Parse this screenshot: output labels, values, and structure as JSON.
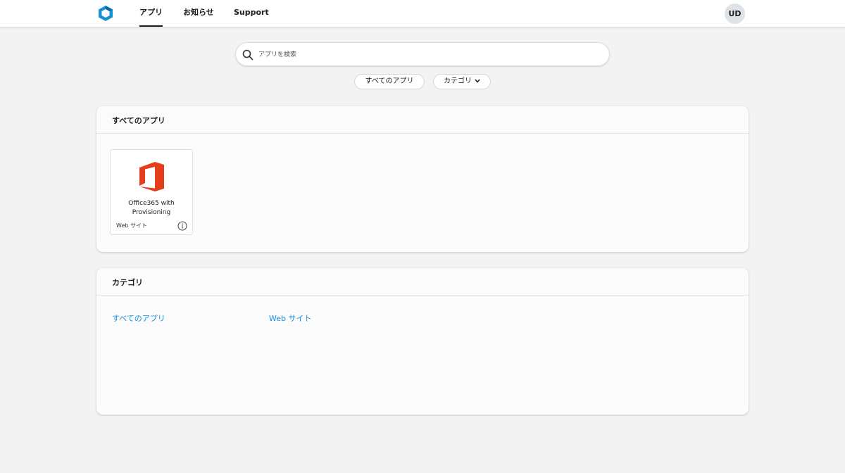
{
  "header": {
    "nav": [
      {
        "label": "アプリ",
        "active": true
      },
      {
        "label": "お知らせ",
        "active": false
      },
      {
        "label": "Support",
        "active": false
      }
    ],
    "avatar": "UD",
    "logo_icon": "cube-logo-icon"
  },
  "search": {
    "placeholder": "アプリを検索",
    "value": ""
  },
  "filters": {
    "all_apps": "すべてのアプリ",
    "category": "カテゴリ"
  },
  "apps_section": {
    "title": "すべてのアプリ",
    "apps": [
      {
        "name_line1": "Office365 with",
        "name_line2": "Provisioning",
        "type": "Web サイト",
        "icon": "office-icon"
      }
    ]
  },
  "category_section": {
    "title": "カテゴリ",
    "links": [
      "すべてのアプリ",
      "Web サイト"
    ]
  },
  "colors": {
    "link": "#1a8fd8",
    "logo": "#1a8fd8",
    "office": "#e43e1c"
  }
}
